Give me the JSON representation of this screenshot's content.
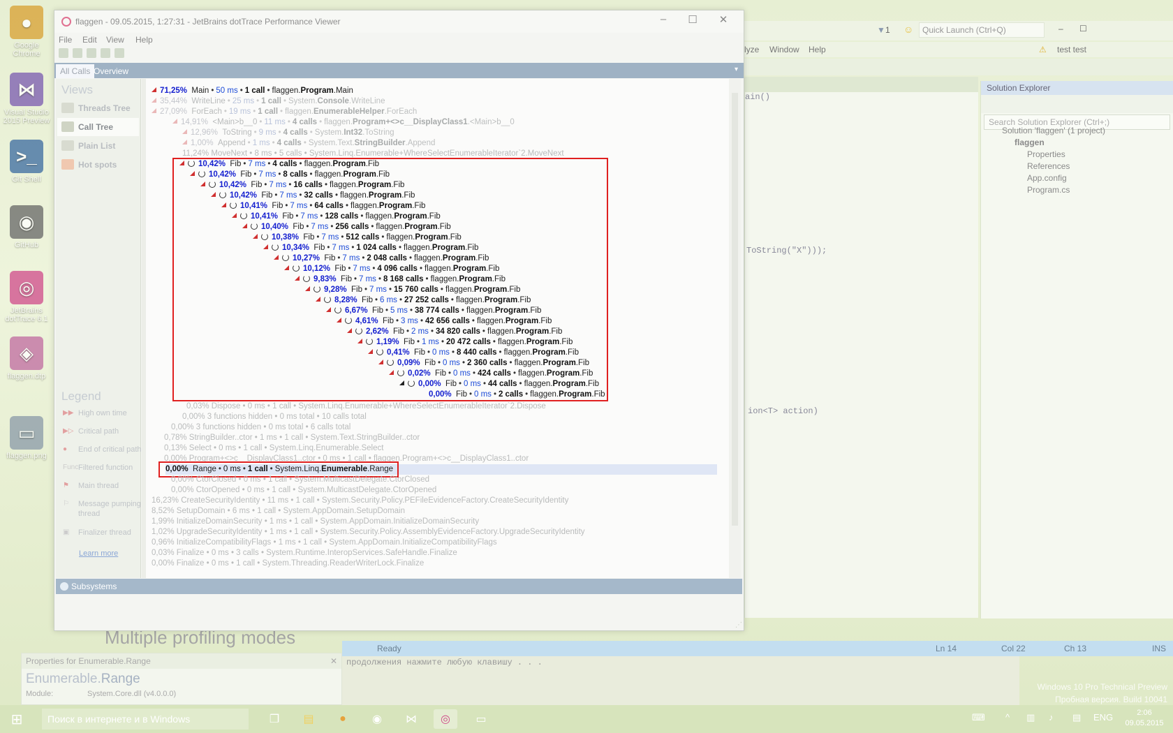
{
  "desktop": {
    "icons": [
      {
        "label": "Google Chrome",
        "color": "#d9a030",
        "glyph": "●"
      },
      {
        "label": "Visual Studio 2015 Preview",
        "color": "#7a5ab0",
        "glyph": "⋈"
      },
      {
        "label": "Git Shell",
        "color": "#3a6aa0",
        "glyph": ">_"
      },
      {
        "label": "GitHub",
        "color": "#666666",
        "glyph": "◉"
      },
      {
        "label": "JetBrains dotTrace 6.1",
        "color": "#d04a8a",
        "glyph": "◎"
      },
      {
        "label": "flaggen.dtp",
        "color": "#c06aa0",
        "glyph": "◈"
      },
      {
        "label": "flaggen.png",
        "color": "#8a9aa8",
        "glyph": "▭"
      }
    ]
  },
  "background_vs": {
    "quick_launch": "Quick Launch (Ctrl+Q)",
    "menu": [
      "lyze",
      "Window",
      "Help"
    ],
    "user": "test test",
    "flag_count": "1",
    "editor_code": [
      "ain()",
      "ToString(\"X\")));",
      "ion<T> action)"
    ],
    "solution_explorer": {
      "title": "Solution Explorer",
      "search": "Search Solution Explorer (Ctrl+;)",
      "nodes": [
        "Solution 'flaggen' (1 project)",
        "flaggen",
        "Properties",
        "References",
        "App.config",
        "Program.cs"
      ]
    },
    "status": {
      "ready": "Ready",
      "ln": "Ln 14",
      "col": "Col 22",
      "ch": "Ch 13",
      "ins": "INS"
    },
    "console_text": "продолжения нажмите любую клавишу . . .",
    "big_text": "Multiple profiling modes",
    "properties": {
      "title": "Properties for Enumerable.Range",
      "name_prefix": "Enumerable.",
      "name_main": "Range",
      "module_label": "Module:",
      "module_value": "System.Core.dll (v4.0.0.0)"
    },
    "watermark": [
      "Windows 10 Pro Technical Preview",
      "Пробная версия. Build 10041"
    ]
  },
  "taskbar": {
    "search_placeholder": "Поиск в интернете и в Windows",
    "lang": "ENG",
    "time": "2:06",
    "date": "09.05.2015"
  },
  "window": {
    "title": "flaggen - 09.05.2015, 1:27:31 - JetBrains dotTrace Performance Viewer",
    "menu": [
      "File",
      "Edit",
      "View",
      "Help"
    ],
    "tabs": [
      "All Calls",
      "Overview"
    ],
    "views_title": "Views",
    "views": [
      "Threads Tree",
      "Call Tree",
      "Plain List",
      "Hot spots"
    ],
    "legend_title": "Legend",
    "legend": [
      "High own time",
      "Critical path",
      "End of critical path",
      "Filtered function",
      "Main thread",
      "Message pumping thread",
      "Finalizer thread"
    ],
    "learn_more": "Learn more",
    "subsystems": "Subsystems"
  },
  "tree_top": [
    {
      "pct": "71,25%",
      "name": "Main",
      "ms": "50 ms",
      "calls": "1 call",
      "pre": "flaggen.",
      "cls": "Program",
      "post": ".Main",
      "indent": 0,
      "dim": false
    },
    {
      "pct": "35,44%",
      "name": "WriteLine",
      "ms": "25 ms",
      "calls": "1 call",
      "pre": "System.",
      "cls": "Console",
      "post": ".WriteLine",
      "indent": 0,
      "dim": true
    },
    {
      "pct": "27,09%",
      "name": "ForEach",
      "ms": "19 ms",
      "calls": "1 call",
      "pre": "flaggen.",
      "cls": "EnumerableHelper",
      "post": ".ForEach",
      "indent": 0,
      "dim": true
    },
    {
      "pct": "14,91%",
      "name": "<Main>b__0",
      "ms": "11 ms",
      "calls": "4 calls",
      "pre": "flaggen.",
      "cls": "Program+<>c__DisplayClass1",
      "post": ".<Main>b__0",
      "indent": 1,
      "dim": true
    },
    {
      "pct": "12,96%",
      "name": "ToString",
      "ms": "9 ms",
      "calls": "4 calls",
      "pre": "System.",
      "cls": "Int32",
      "post": ".ToString",
      "indent": 2,
      "dim": true
    },
    {
      "pct": "1,00%",
      "name": "Append",
      "ms": "1 ms",
      "calls": "4 calls",
      "pre": "System.Text.",
      "cls": "StringBuilder",
      "post": ".Append",
      "indent": 2,
      "dim": true
    }
  ],
  "fib_rows": [
    {
      "pct": "10,42%",
      "ms": "7 ms",
      "calls": "4 calls"
    },
    {
      "pct": "10,42%",
      "ms": "7 ms",
      "calls": "8 calls"
    },
    {
      "pct": "10,42%",
      "ms": "7 ms",
      "calls": "16 calls"
    },
    {
      "pct": "10,42%",
      "ms": "7 ms",
      "calls": "32 calls"
    },
    {
      "pct": "10,41%",
      "ms": "7 ms",
      "calls": "64 calls"
    },
    {
      "pct": "10,41%",
      "ms": "7 ms",
      "calls": "128 calls"
    },
    {
      "pct": "10,40%",
      "ms": "7 ms",
      "calls": "256 calls"
    },
    {
      "pct": "10,38%",
      "ms": "7 ms",
      "calls": "512 calls"
    },
    {
      "pct": "10,34%",
      "ms": "7 ms",
      "calls": "1 024 calls"
    },
    {
      "pct": "10,27%",
      "ms": "7 ms",
      "calls": "2 048 calls"
    },
    {
      "pct": "10,12%",
      "ms": "7 ms",
      "calls": "4 096 calls"
    },
    {
      "pct": "9,83%",
      "ms": "7 ms",
      "calls": "8 168 calls"
    },
    {
      "pct": "9,28%",
      "ms": "7 ms",
      "calls": "15 760 calls"
    },
    {
      "pct": "8,28%",
      "ms": "6 ms",
      "calls": "27 252 calls"
    },
    {
      "pct": "6,67%",
      "ms": "5 ms",
      "calls": "38 774 calls"
    },
    {
      "pct": "4,61%",
      "ms": "3 ms",
      "calls": "42 656 calls"
    },
    {
      "pct": "2,62%",
      "ms": "2 ms",
      "calls": "34 820 calls"
    },
    {
      "pct": "1,19%",
      "ms": "1 ms",
      "calls": "20 472 calls"
    },
    {
      "pct": "0,41%",
      "ms": "0 ms",
      "calls": "8 440 calls"
    },
    {
      "pct": "0,09%",
      "ms": "0 ms",
      "calls": "2 360 calls"
    },
    {
      "pct": "0,02%",
      "ms": "0 ms",
      "calls": "424 calls"
    },
    {
      "pct": "0,00%",
      "ms": "0 ms",
      "calls": "44 calls"
    },
    {
      "pct": "0,00%",
      "ms": "0 ms",
      "calls": "2 calls"
    }
  ],
  "fib_func": {
    "name": "Fib",
    "pre": "flaggen.",
    "cls": "Program",
    "post": ".Fib"
  },
  "tree_bottom": [
    {
      "text": "0,03%  Dispose  •  0 ms  •  1 call  •  System.Linq.Enumerable+WhereSelectEnumerableIterator`2.Dispose"
    },
    {
      "text": "0,00%  3 functions hidden  •  0 ms total  •  10 calls total"
    },
    {
      "text": "0,00%  3 functions hidden  •  0 ms total  •  6 calls total"
    },
    {
      "text": "0,78%  StringBuilder..ctor  •  1 ms  •  1 call  •  System.Text.StringBuilder..ctor"
    },
    {
      "text": "0,13%  Select  •  0 ms  •  1 call  •  System.Linq.Enumerable.Select"
    },
    {
      "text": "0,00%  Program+<>c__DisplayClass1..ctor  •  0 ms  •  1 call  •  flaggen.Program+<>c__DisplayClass1..ctor"
    },
    {
      "text": "0,00%  CtorClosed  •  0 ms  •  1 call  •  System.MulticastDelegate.CtorClosed"
    },
    {
      "text": "0,00%  CtorOpened  •  0 ms  •  1 call  •  System.MulticastDelegate.CtorOpened"
    },
    {
      "text": "16,23%  CreateSecurityIdentity  •  11 ms  •  1 call  •  System.Security.Policy.PEFileEvidenceFactory.CreateSecurityIdentity"
    },
    {
      "text": "8,52%  SetupDomain  •  6 ms  •  1 call  •  System.AppDomain.SetupDomain"
    },
    {
      "text": "1,99%  InitializeDomainSecurity  •  1 ms  •  1 call  •  System.AppDomain.InitializeDomainSecurity"
    },
    {
      "text": "1,02%  UpgradeSecurityIdentity  •  1 ms  •  1 call  •  System.Security.Policy.AssemblyEvidenceFactory.UpgradeSecurityIdentity"
    },
    {
      "text": "0,96%  InitializeCompatibilityFlags  •  1 ms  •  1 call  •  System.AppDomain.InitializeCompatibilityFlags"
    },
    {
      "text": "0,03%  Finalize  •  0 ms  •  3 calls  •  System.Runtime.InteropServices.SafeHandle.Finalize"
    },
    {
      "text": "0,00%  Finalize  •  0 ms  •  1 call  •  System.Threading.ReaderWriterLock.Finalize"
    }
  ],
  "movenext_row": {
    "text": "11,24%  MoveNext  •  8 ms  •  5 calls  •  System.Linq.Enumerable+WhereSelectEnumerableIterator`2.MoveNext"
  },
  "selected_row": {
    "pct": "0,00%",
    "name": "Range",
    "ms": "0 ms",
    "calls": "1 call",
    "pre": "System.Linq.",
    "cls": "Enumerable",
    "post": ".Range"
  }
}
